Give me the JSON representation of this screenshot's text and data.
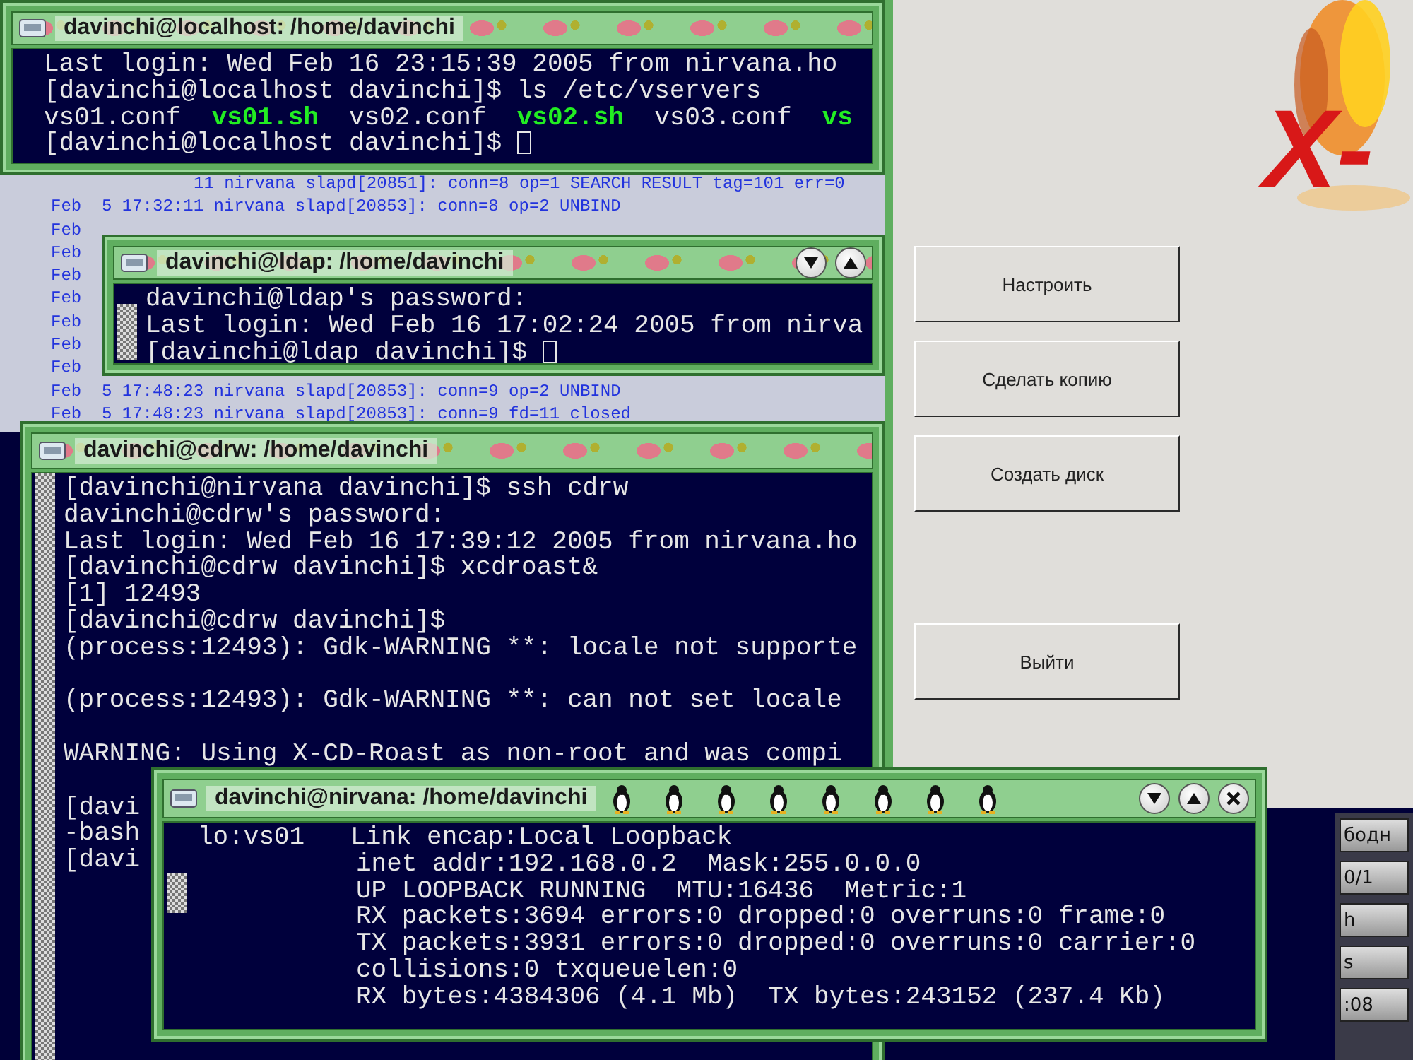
{
  "log_window": {
    "lines": [
      {
        "kind": "tail",
        "text": "11 nirvana slapd[20851]: conn=8 op=1 SEARCH RESULT tag=101 err=0"
      },
      {
        "kind": "full",
        "text": "Feb  5 17:32:11 nirvana slapd[20853]: conn=8 op=2 UNBIND"
      },
      {
        "kind": "full",
        "text": "Feb"
      },
      {
        "kind": "full",
        "text": "Feb"
      },
      {
        "kind": "full",
        "text": "Feb"
      },
      {
        "kind": "full",
        "text": "Feb"
      },
      {
        "kind": "full",
        "text": "Feb"
      },
      {
        "kind": "full",
        "text": "Feb"
      },
      {
        "kind": "full",
        "text": "Feb"
      },
      {
        "kind": "full",
        "text": "Feb  5 17:48:23 nirvana slapd[20853]: conn=9 op=2 UNBIND"
      },
      {
        "kind": "full",
        "text": "Feb  5 17:48:23 nirvana slapd[20853]: conn=9 fd=11 closed"
      }
    ]
  },
  "terminals": [
    {
      "title": "davinchi@localhost: /home/davinchi",
      "kind": "flowers",
      "lines": [
        {
          "kind": "text",
          "text": "Last login: Wed Feb 16 23:15:39 2005 from nirvana.ho"
        },
        {
          "kind": "text",
          "text": "[davinchi@localhost davinchi]$ ls /etc/vservers"
        },
        {
          "kind": "files",
          "files": [
            {
              "name": "vs01.conf",
              "kind": "conf"
            },
            {
              "name": "vs01.sh",
              "kind": "script"
            },
            {
              "name": "vs02.conf",
              "kind": "conf"
            },
            {
              "name": "vs02.sh",
              "kind": "script"
            },
            {
              "name": "vs03.conf",
              "kind": "conf"
            },
            {
              "name": "vs",
              "kind": "script"
            }
          ]
        },
        {
          "kind": "prompt",
          "text": "[davinchi@localhost davinchi]$"
        }
      ]
    },
    {
      "title": "davinchi@ldap: /home/davinchi",
      "kind": "flowers",
      "buttons": [
        {
          "kind": "minimize"
        },
        {
          "kind": "maximize"
        }
      ],
      "lines": [
        {
          "kind": "text",
          "text": "davinchi@ldap's password:"
        },
        {
          "kind": "text",
          "text": "Last login: Wed Feb 16 17:02:24 2005 from nirva"
        },
        {
          "kind": "prompt",
          "text": "[davinchi@ldap davinchi]$"
        }
      ]
    },
    {
      "title": "davinchi@cdrw: /home/davinchi",
      "kind": "flowers",
      "lines": [
        {
          "kind": "text",
          "text": "[davinchi@nirvana davinchi]$ ssh cdrw"
        },
        {
          "kind": "text",
          "text": "davinchi@cdrw's password:"
        },
        {
          "kind": "text",
          "text": "Last login: Wed Feb 16 17:39:12 2005 from nirvana.ho"
        },
        {
          "kind": "text",
          "text": "[davinchi@cdrw davinchi]$ xcdroast&"
        },
        {
          "kind": "text",
          "text": "[1] 12493"
        },
        {
          "kind": "text",
          "text": "[davinchi@cdrw davinchi]$"
        },
        {
          "kind": "text",
          "text": "(process:12493): Gdk-WARNING **: locale not supporte"
        },
        {
          "kind": "blank"
        },
        {
          "kind": "text",
          "text": "(process:12493): Gdk-WARNING **: can not set locale"
        },
        {
          "kind": "blank"
        },
        {
          "kind": "text",
          "text": "WARNING: Using X-CD-Roast as non-root and was compi"
        },
        {
          "kind": "blank"
        },
        {
          "kind": "text",
          "text": "[davi"
        },
        {
          "kind": "text",
          "text": "-bash"
        },
        {
          "kind": "text",
          "text": "[davi"
        }
      ]
    },
    {
      "title": "davinchi@nirvana: /home/davinchi",
      "kind": "penguins",
      "buttons": [
        {
          "kind": "minimize"
        },
        {
          "kind": "maximize"
        },
        {
          "kind": "close"
        }
      ],
      "lines": [
        {
          "kind": "text",
          "text": "lo:vs01   Link encap:Local Loopback"
        },
        {
          "kind": "indent",
          "text": "inet addr:192.168.0.2  Mask:255.0.0.0"
        },
        {
          "kind": "indent",
          "text": "UP LOOPBACK RUNNING  MTU:16436  Metric:1"
        },
        {
          "kind": "indent",
          "text": "RX packets:3694 errors:0 dropped:0 overruns:0 frame:0"
        },
        {
          "kind": "indent",
          "text": "TX packets:3931 errors:0 dropped:0 overruns:0 carrier:0"
        },
        {
          "kind": "indent",
          "text": "collisions:0 txqueuelen:0"
        },
        {
          "kind": "indent",
          "text": "RX bytes:4384306 (4.1 Mb)  TX bytes:243152 (237.4 Kb)"
        }
      ]
    }
  ],
  "xcdroast": {
    "logo": "X-",
    "buttons": [
      "Настроить",
      "Сделать копию",
      "Создать диск",
      "Выйти"
    ]
  },
  "panel": {
    "items": [
      "бодн",
      "0/1",
      "h",
      "s",
      ":08"
    ]
  }
}
